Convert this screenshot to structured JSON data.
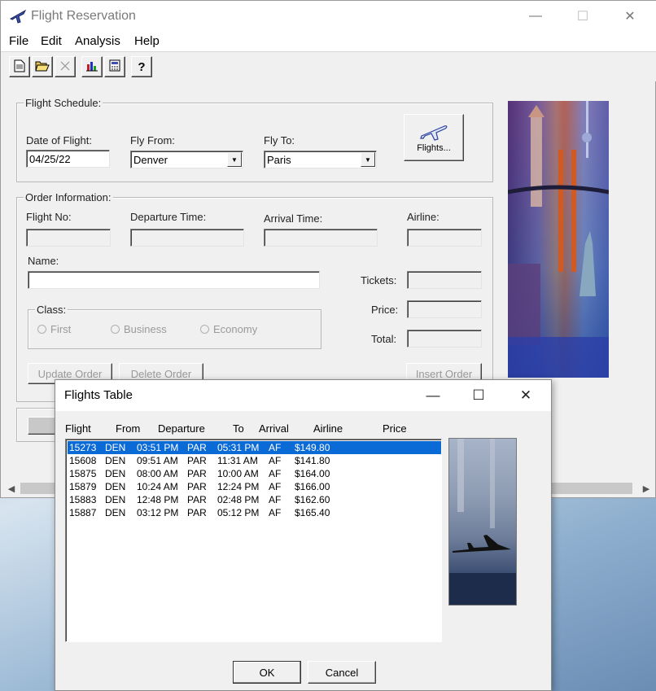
{
  "window": {
    "title": "Flight Reservation",
    "controls": {
      "minimize": "—",
      "maximize": "☐",
      "close": "✕"
    }
  },
  "menu": [
    "File",
    "Edit",
    "Analysis",
    "Help"
  ],
  "toolbar": {
    "icons": [
      "new-document-icon",
      "open-folder-icon",
      "delete-x-icon",
      "bar-chart-icon",
      "calculator-icon",
      "help-question-icon"
    ],
    "help_glyph": "?"
  },
  "schedule": {
    "group_label": "Flight Schedule:",
    "date_label": "Date of Flight:",
    "date_value": "04/25/22",
    "from_label": "Fly From:",
    "from_value": "Denver",
    "to_label": "Fly To:",
    "to_value": "Paris",
    "flights_button": "Flights..."
  },
  "order": {
    "group_label": "Order Information:",
    "flight_no_label": "Flight No:",
    "departure_label": "Departure Time:",
    "arrival_label": "Arrival Time:",
    "airline_label": "Airline:",
    "name_label": "Name:",
    "tickets_label": "Tickets:",
    "price_label": "Price:",
    "total_label": "Total:",
    "class_label": "Class:",
    "classes": [
      "First",
      "Business",
      "Economy"
    ],
    "update_button": "Update Order",
    "delete_button": "Delete Order",
    "insert_button": "Insert Order"
  },
  "dialog": {
    "title": "Flights Table",
    "controls": {
      "minimize": "—",
      "maximize": "☐",
      "close": "✕"
    },
    "columns": [
      "Flight",
      "From",
      "Departure",
      "To",
      "Arrival",
      "Airline",
      "Price"
    ],
    "rows": [
      [
        "15273",
        "DEN",
        "03:51 PM",
        "PAR",
        "05:31 PM",
        "AF",
        "$149.80"
      ],
      [
        "15608",
        "DEN",
        "09:51 AM",
        "PAR",
        "11:31 AM",
        "AF",
        "$141.80"
      ],
      [
        "15875",
        "DEN",
        "08:00 AM",
        "PAR",
        "10:00 AM",
        "AF",
        "$164.00"
      ],
      [
        "15879",
        "DEN",
        "10:24 AM",
        "PAR",
        "12:24 PM",
        "AF",
        "$166.00"
      ],
      [
        "15883",
        "DEN",
        "12:48 PM",
        "PAR",
        "02:48 PM",
        "AF",
        "$162.60"
      ],
      [
        "15887",
        "DEN",
        "03:12 PM",
        "PAR",
        "05:12 PM",
        "AF",
        "$165.40"
      ]
    ],
    "selected_row": 0,
    "ok_button": "OK",
    "cancel_button": "Cancel"
  },
  "colors": {
    "selection": "#0a6ad6",
    "window_bg": "#f0f0f0"
  }
}
